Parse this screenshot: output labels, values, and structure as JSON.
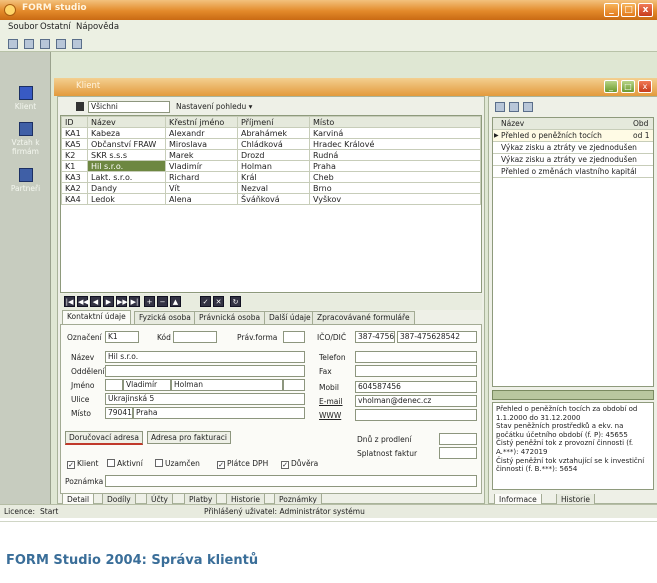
{
  "window": {
    "title": "FORM studio",
    "min": "_",
    "max": "□",
    "close": "x"
  },
  "menu": [
    "Soubor",
    "Ostatní",
    "Nápověda"
  ],
  "toolbar": {
    "icons": [
      "first-icon",
      "list-icon",
      "copy-icon",
      "edit-icon",
      "view-icon"
    ]
  },
  "leftnav": [
    {
      "label": "Klient"
    },
    {
      "label": "Vztah k firmám"
    },
    {
      "label": "Partneři"
    }
  ],
  "inner": {
    "title": "Klient"
  },
  "gridbar": {
    "filter_value": "Všichni",
    "view_label": "Nastavení pohledu ▾"
  },
  "grid": {
    "columns": [
      "ID",
      "Název",
      "Křestní jméno",
      "Příjmení",
      "Místo"
    ],
    "rows": [
      {
        "id": "KA1",
        "name": "Kabeza",
        "first": "Alexandr",
        "last": "Abrahámek",
        "city": "Karviná"
      },
      {
        "id": "KA5",
        "name": "Občanství FRAW",
        "first": "Miroslava",
        "last": "Chládková",
        "city": "Hradec Králové"
      },
      {
        "id": "K2",
        "name": "SKR s.s.s",
        "first": "Marek",
        "last": "Drozd",
        "city": "Rudná"
      },
      {
        "id": "K1",
        "name": "Hil s.r.o.",
        "first": "Vladimír",
        "last": "Holman",
        "city": "Praha"
      },
      {
        "id": "KA3",
        "name": "Lakt. s.r.o.",
        "first": "Richard",
        "last": "Král",
        "city": "Cheb"
      },
      {
        "id": "KA2",
        "name": "Dandy",
        "first": "Vít",
        "last": "Nezval",
        "city": "Brno"
      },
      {
        "id": "KA4",
        "name": "Ledok",
        "first": "Alena",
        "last": "Šváňková",
        "city": "Vyškov"
      }
    ]
  },
  "tabs": [
    "Kontaktní údaje",
    "Fyzická osoba",
    "Právnická osoba",
    "Další údaje",
    "Zpracovávané formuláře"
  ],
  "form": {
    "oznaceni_label": "Označení",
    "oznaceni_value": "K1",
    "kod_label": "Kód",
    "kod_value": "",
    "pravforma_label": "Práv.forma",
    "pravforma_value": "",
    "ico_label": "IČO/DIČ",
    "ico_value": "387-4756",
    "dic_value": "387-475628542",
    "nazev_label": "Název",
    "nazev_value": "Hil s.r.o.",
    "oddeleni_label": "Oddělení",
    "jmeno_label": "Jméno",
    "jmeno_value": "Vladimír",
    "prijmeni_value": "Holman",
    "ulice_label": "Ulice",
    "ulice_value": "Ukrajinská 5",
    "misto_label": "Místo",
    "psc_value": "79041",
    "misto_value": "Praha",
    "telefon_label": "Telefon",
    "fax_label": "Fax",
    "mobil_label": "Mobil",
    "mobil_value": "604587456",
    "email_label": "E-mail",
    "email_value": "vholman@denec.cz",
    "www_label": "WWW",
    "dorucovaci_button": "Doručovací adresa",
    "fakturacni_button": "Adresa pro fakturaci",
    "dnu_label": "Dnů z prodlení",
    "splatnost_label": "Splatnost faktur",
    "cb_klient": "Klient",
    "cb_aktivni": "Aktivní",
    "cb_uzamcen": "Uzamčen",
    "cb_platce": "Plátce DPH",
    "cb_duvera": "Důvěra",
    "poznamka_label": "Poznámka"
  },
  "bottomtabs": [
    "Detail",
    "Dodíly",
    "Účty",
    "Platby",
    "Historie",
    "Poznámky"
  ],
  "right": {
    "header": "Název",
    "header2": "Obd",
    "items": [
      {
        "label": "Přehled o peněžních tocích",
        "val": "od 1"
      },
      {
        "label": "Výkaz zisku a ztráty ve zjednodušen"
      },
      {
        "label": "Výkaz zisku a ztráty ve zjednodušen"
      },
      {
        "label": "Přehled o změnách vlastního kapitál"
      }
    ],
    "info": "Přehled o peněžních tocích za období od 1.1.2000 do 31.12.2000\nStav peněžních prostředků a ekv. na počátku účetního období (f. P): 45655\nČistý peněžní tok z provozní činnosti (f. A.***): 472019\nČistý peněžní tok vztahující se k investiční činnosti (f. B.***): 5654",
    "tabs": [
      "Informace",
      "Historie"
    ]
  },
  "statusbar": {
    "licence": "Licence:",
    "start": "Start",
    "user": "Přihlášený uživatel: Administrátor systému"
  },
  "caption": "FORM Studio 2004: Správa klientů"
}
